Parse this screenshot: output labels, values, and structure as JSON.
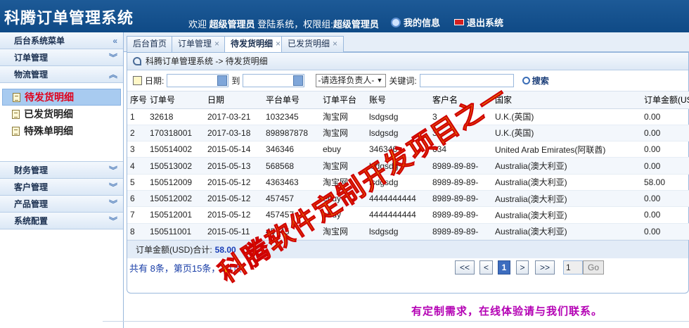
{
  "header": {
    "title": "科腾订单管理系统",
    "welcome": "欢迎",
    "user": "超级管理员",
    "login_text": "登陆系统，权限组:",
    "group": "超级管理员",
    "my_info": "我的信息",
    "logout": "退出系统"
  },
  "sidebar": {
    "title": "后台系统菜单",
    "order_mgmt": "订单管理",
    "logistics": "物流管理",
    "items": [
      {
        "label": "待发货明细"
      },
      {
        "label": "已发货明细"
      },
      {
        "label": "特殊单明细"
      }
    ],
    "finance": "财务管理",
    "customer": "客户管理",
    "product": "产品管理",
    "system": "系统配置"
  },
  "tabs": [
    {
      "label": "后台首页"
    },
    {
      "label": "订单管理"
    },
    {
      "label": "待发货明细"
    },
    {
      "label": "已发货明细"
    }
  ],
  "breadcrumb": "科腾订单管理系统 -> 待发货明细",
  "filters": {
    "date_label": "日期:",
    "to_label": "到",
    "owner_select": "-请选择负责人-",
    "keyword_label": "关键词:",
    "search": "搜索"
  },
  "table": {
    "headers": [
      "序号",
      "订单号",
      "日期",
      "平台单号",
      "订单平台",
      "账号",
      "客户名",
      "国家",
      "订单金额(USD)"
    ],
    "rows": [
      [
        "1",
        "32618",
        "2017-03-21",
        "1032345",
        "淘宝网",
        "lsdgsdg",
        "3",
        "U.K.(英国)",
        "0.00"
      ],
      [
        "2",
        "170318001",
        "2017-03-18",
        "898987878",
        "淘宝网",
        "lsdgsdg",
        "3",
        "U.K.(英国)",
        "0.00"
      ],
      [
        "3",
        "150514002",
        "2015-05-14",
        "346346",
        "ebuy",
        "346346",
        "634",
        "United Arab Emirates(阿联酋)",
        "0.00"
      ],
      [
        "4",
        "150513002",
        "2015-05-13",
        "568568",
        "淘宝网",
        "lsdgsdg",
        "8989-89-89-",
        "Australia(澳大利亚)",
        "0.00"
      ],
      [
        "5",
        "150512009",
        "2015-05-12",
        "4363463",
        "淘宝网",
        "lsdgsdg",
        "8989-89-89-",
        "Australia(澳大利亚)",
        "58.00"
      ],
      [
        "6",
        "150512002",
        "2015-05-12",
        "457457",
        "ebuy",
        "4444444444",
        "8989-89-89-",
        "Australia(澳大利亚)",
        "0.00"
      ],
      [
        "7",
        "150512001",
        "2015-05-12",
        "457457",
        "ebuy",
        "4444444444",
        "8989-89-89-",
        "Australia(澳大利亚)",
        "0.00"
      ],
      [
        "8",
        "150511001",
        "2015-05-11",
        "45745",
        "淘宝网",
        "lsdgsdg",
        "8989-89-89-",
        "Australia(澳大利亚)",
        "0.00"
      ]
    ]
  },
  "total": {
    "label": "订单金额(USD)合计:",
    "amount": "58.00"
  },
  "pager": {
    "info": "共有 8条，第页15条，1/1页",
    "first": "<<",
    "prev": "<",
    "current": "1",
    "next": ">",
    "last": ">>",
    "page_input": "1",
    "go": "Go"
  },
  "footer_note": "有定制需求，在线体验请与我们联系。",
  "watermark": "科腾软件定制开发项目之一",
  "colors": {
    "header_bg": "#1d5a97",
    "active_menu": "#e0001b",
    "footer_note": "#b400b4"
  }
}
